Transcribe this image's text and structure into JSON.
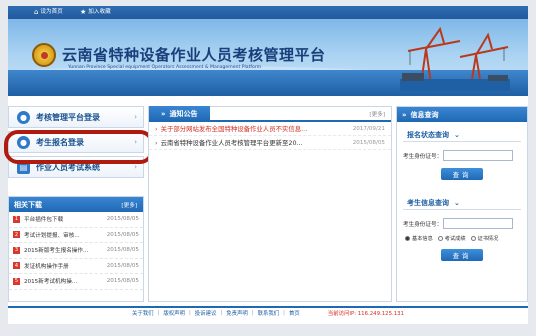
{
  "topbar": {
    "set_home": "设为首页",
    "favorite": "加入收藏"
  },
  "header": {
    "title": "云南省特种设备作业人员考核管理平台",
    "subtitle": "Yunnan Province Special equipment Operators Assessment & Management Platform"
  },
  "nav": [
    {
      "label": "考核管理平台登录",
      "icon": "user-icon"
    },
    {
      "label": "考生报名登录",
      "icon": "users-icon"
    },
    {
      "label": "作业人员考试系统",
      "icon": "document-icon"
    }
  ],
  "downloads": {
    "title": "相关下载",
    "more": "更多",
    "items": [
      {
        "num": "1",
        "title": "平台插件包下载",
        "date": "2015/08/05"
      },
      {
        "num": "2",
        "title": "考试计划提报、审核...",
        "date": "2015/08/05"
      },
      {
        "num": "3",
        "title": "2015新版考生报名操作...",
        "date": "2015/08/05"
      },
      {
        "num": "4",
        "title": "发证机构操作手册",
        "date": "2015/08/05"
      },
      {
        "num": "5",
        "title": "2015新考试机构操...",
        "date": "2015/08/05"
      }
    ]
  },
  "notices": {
    "title": "通知公告",
    "more": "更多",
    "items": [
      {
        "title": "关于部分网站发布全国特种设备作业人员不实信息...",
        "date": "2017/09/21",
        "highlight": true
      },
      {
        "title": "云南省特种设备作业人员考核管理平台更新至20...",
        "date": "2015/08/05",
        "highlight": false
      }
    ]
  },
  "info_query": {
    "title": "信息查询",
    "status_section": "报名状态查询",
    "info_section": "考生信息查询",
    "id_label": "考生身份证号：",
    "button": "查询",
    "radio_options": [
      "基本信息",
      "考试成绩",
      "证书情况"
    ],
    "selected_radio": "基本信息"
  },
  "footer": {
    "links": [
      "关于我们",
      "版权声明",
      "投诉建议",
      "免责声明",
      "联系我们",
      "首页"
    ],
    "ip_text": "当前访问IP: 116.249.125.131"
  },
  "colors": {
    "brand": "#1f68b4",
    "alert": "#d52c1f",
    "annotation": "#b01b10"
  }
}
